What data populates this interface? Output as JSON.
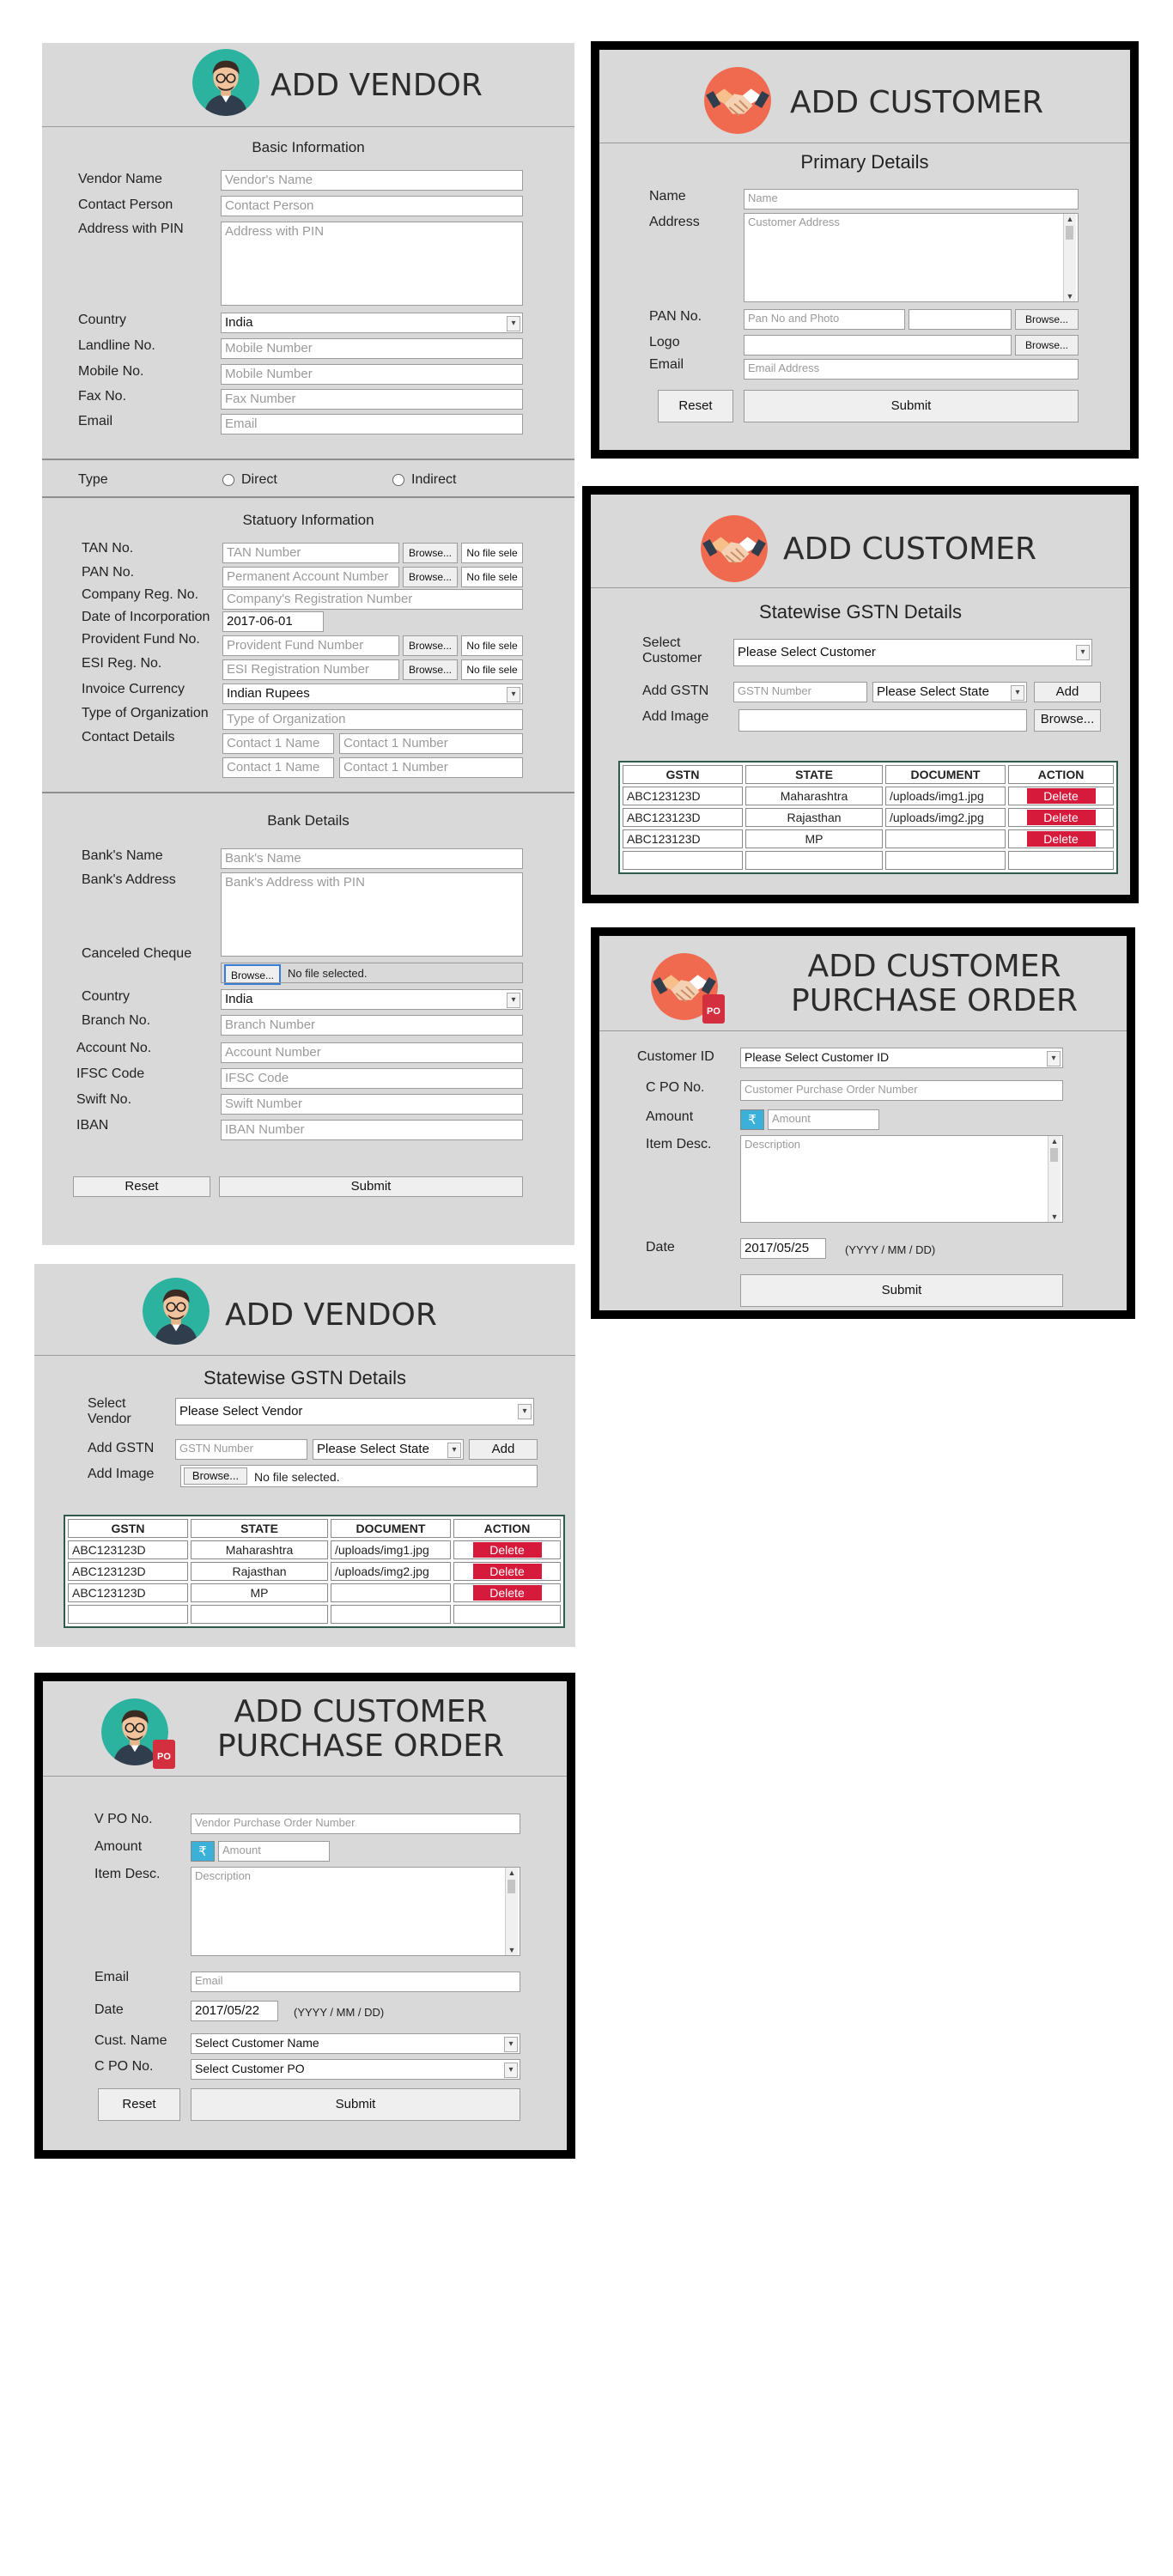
{
  "vendor_form": {
    "title": "ADD VENDOR",
    "basic_info_title": "Basic Information",
    "labels": {
      "vendor_name": "Vendor Name",
      "contact_person": "Contact Person",
      "address": "Address with PIN",
      "country": "Country",
      "landline": "Landline No.",
      "mobile": "Mobile No.",
      "fax": "Fax No.",
      "email": "Email",
      "type": "Type"
    },
    "placeholders": {
      "vendor_name": "Vendor's Name",
      "contact_person": "Contact Person",
      "address": "Address with PIN",
      "landline": "Mobile Number",
      "mobile": "Mobile Number",
      "fax": "Fax Number",
      "email": "Email"
    },
    "country_value": "India",
    "type_options": [
      "Direct",
      "Indirect"
    ],
    "statutory_title": "Statuory Information",
    "statutory_labels": {
      "tan": "TAN No.",
      "pan": "PAN No.",
      "company_reg": "Company Reg. No.",
      "doi": "Date of Incorporation",
      "pf": "Provident Fund No.",
      "esi": "ESI Reg. No.",
      "currency": "Invoice Currency",
      "org_type": "Type of Organization",
      "contact": "Contact Details"
    },
    "statutory_placeholders": {
      "tan": "TAN Number",
      "pan": "Permanent Account Number",
      "company_reg": "Company's Registration Number",
      "pf": "Provident Fund Number",
      "esi": "ESI Registration Number",
      "org_type": "Type of Organization",
      "contact1_name": "Contact 1 Name",
      "contact1_number": "Contact 1 Number",
      "contact2_name": "Contact 1 Name",
      "contact2_number": "Contact 1 Number"
    },
    "doi_value": "2017-06-01",
    "currency_value": "Indian Rupees",
    "browse_label": "Browse...",
    "no_file_short": "No file sele",
    "bank_title": "Bank Details",
    "bank_labels": {
      "bank_name": "Bank's Name",
      "bank_address": "Bank's Address",
      "cheque": "Canceled Cheque",
      "country": "Country",
      "branch": "Branch No.",
      "account": "Account No.",
      "ifsc": "IFSC Code",
      "swift": "Swift No.",
      "iban": "IBAN"
    },
    "bank_placeholders": {
      "bank_name": "Bank's Name",
      "bank_address": "Bank's Address with PIN",
      "branch": "Branch Number",
      "account": "Account Number",
      "ifsc": "IFSC Code",
      "swift": "Swift Number",
      "iban": "IBAN Number"
    },
    "no_file_selected": "No file selected.",
    "bank_country_value": "India",
    "reset_label": "Reset",
    "submit_label": "Submit"
  },
  "customer_primary": {
    "title": "ADD CUSTOMER",
    "section_title": "Primary Details",
    "labels": {
      "name": "Name",
      "address": "Address",
      "pan": "PAN No.",
      "logo": "Logo",
      "email": "Email"
    },
    "placeholders": {
      "name": "Name",
      "address": "Customer Address",
      "pan": "Pan No and Photo",
      "email": "Email Address"
    },
    "browse_label": "Browse...",
    "reset_label": "Reset",
    "submit_label": "Submit"
  },
  "customer_gstn": {
    "title": "ADD CUSTOMER",
    "section_title": "Statewise GSTN Details",
    "select_label": "Select Customer",
    "select_value": "Please Select Customer",
    "add_gstn_label": "Add GSTN",
    "gstn_placeholder": "GSTN Number",
    "state_value": "Please Select State",
    "add_label": "Add",
    "add_image_label": "Add Image",
    "browse_label": "Browse...",
    "columns": [
      "GSTN",
      "STATE",
      "DOCUMENT",
      "ACTION"
    ],
    "rows": [
      {
        "gstn": "ABC123123D",
        "state": "Maharashtra",
        "document": "/uploads/img1.jpg",
        "action": "Delete"
      },
      {
        "gstn": "ABC123123D",
        "state": "Rajasthan",
        "document": "/uploads/img2.jpg",
        "action": "Delete"
      },
      {
        "gstn": "ABC123123D",
        "state": "MP",
        "document": "",
        "action": "Delete"
      }
    ]
  },
  "customer_po": {
    "title_line1": "ADD CUSTOMER",
    "title_line2": "PURCHASE ORDER",
    "badge": "PO",
    "labels": {
      "customer_id": "Customer ID",
      "cpo": "C PO No.",
      "amount": "Amount",
      "desc": "Item Desc.",
      "date": "Date"
    },
    "customer_id_value": "Please Select Customer ID",
    "placeholders": {
      "cpo": "Customer Purchase Order Number",
      "amount": "Amount",
      "desc": "Description"
    },
    "rupee": "₹",
    "date_value": "2017/05/25",
    "date_hint": "(YYYY / MM / DD)",
    "submit_label": "Submit"
  },
  "vendor_gstn": {
    "title": "ADD VENDOR",
    "section_title": "Statewise GSTN Details",
    "select_label": "Select Vendor",
    "select_value": "Please Select Vendor",
    "add_gstn_label": "Add GSTN",
    "gstn_placeholder": "GSTN Number",
    "state_value": "Please Select State",
    "add_label": "Add",
    "add_image_label": "Add Image",
    "browse_label": "Browse...",
    "no_file_selected": "No file selected.",
    "columns": [
      "GSTN",
      "STATE",
      "DOCUMENT",
      "ACTION"
    ],
    "rows": [
      {
        "gstn": "ABC123123D",
        "state": "Maharashtra",
        "document": "/uploads/img1.jpg",
        "action": "Delete"
      },
      {
        "gstn": "ABC123123D",
        "state": "Rajasthan",
        "document": "/uploads/img2.jpg",
        "action": "Delete"
      },
      {
        "gstn": "ABC123123D",
        "state": "MP",
        "document": "",
        "action": "Delete"
      }
    ]
  },
  "vendor_po": {
    "title_line1": "ADD CUSTOMER",
    "title_line2": "PURCHASE ORDER",
    "badge": "PO",
    "labels": {
      "vpo": "V PO No.",
      "amount": "Amount",
      "desc": "Item Desc.",
      "email": "Email",
      "date": "Date",
      "cust_name": "Cust. Name",
      "cpo": "C PO No."
    },
    "placeholders": {
      "vpo": "Vendor Purchase Order Number",
      "amount": "Amount",
      "desc": "Description",
      "email": "Email"
    },
    "rupee": "₹",
    "date_value": "2017/05/22",
    "date_hint": "(YYYY / MM / DD)",
    "cust_name_value": "Select Customer Name",
    "cpo_value": "Select Customer PO",
    "reset_label": "Reset",
    "submit_label": "Submit"
  },
  "colors": {
    "panel": "#d9d9d9",
    "delete": "#d61a3c",
    "rupee": "#3bb0d8",
    "frame": "#000000"
  }
}
